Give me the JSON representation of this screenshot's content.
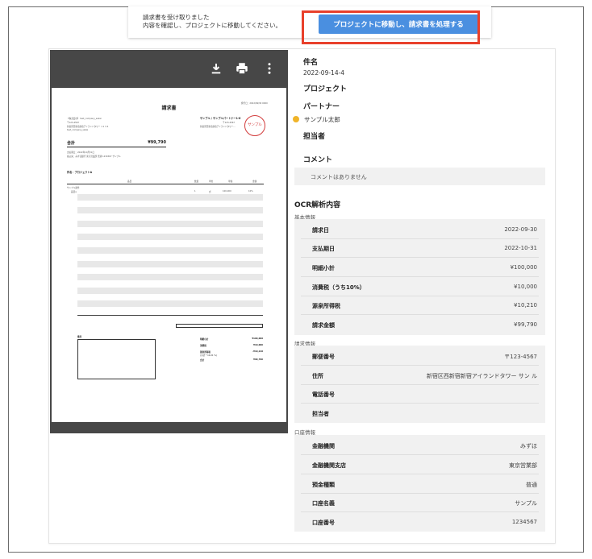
{
  "notice": {
    "line1": "請求書を受け取りました",
    "line2": "内容を確認し、プロジェクトに移動してください。",
    "button_label": "プロジェクトに移動し、請求書を処理する"
  },
  "viewer": {
    "icons": [
      "download-icon",
      "print-icon",
      "more-vert-icon"
    ],
    "doc": {
      "title": "請求書",
      "date_line": "発行日：2022/09/30 0000",
      "customer_name": "【株式会社】 test_company_sakai",
      "customer_zip": "〒123-4567",
      "customer_addr": "新宿区西新宿新宿アイランドタワー 1 1 3 4",
      "customer_person": "test_company_sakai",
      "issuer_name": "サンプル / サンプルパートナー1-6",
      "issuer_zip": "〒123-4567",
      "issuer_addr": "新宿区西新宿新宿アイランドタワー…",
      "seal": "サンプル",
      "total_label": "合計",
      "total_value": "¥99,790",
      "due_line": "支払期日：2022年10月31日",
      "bank_line": "振込先：みずほ銀行 東京営業部 普通 1234567 サンプル",
      "subject": "件名：プロジェクトA",
      "col_item": "品目",
      "col_qty": "数量",
      "col_unit": "単位",
      "col_price": "単価",
      "col_amount": "金額",
      "row_group": "サンプル案件",
      "row_item": "品目a",
      "row_qty": "1",
      "row_unit": "式",
      "row_price": "100,000",
      "row_amount": "10%",
      "memo_label": "備考",
      "sum_subtotal_label": "明細小計",
      "sum_subtotal": "¥100,000",
      "sum_tax_label": "消費税",
      "sum_tax": "¥10,000",
      "sum_wh_label": "源泉所得税",
      "sum_wh_sub": "(小計 * 10.21 %)",
      "sum_wh": "-¥10,210",
      "sum_total_label": "合計",
      "sum_total": "¥99,790"
    }
  },
  "panel": {
    "subject_label": "件名",
    "subject_value": "2022-09-14-4",
    "project_label": "プロジェクト",
    "partner_label": "パートナー",
    "partner_value": "サンプル太郎",
    "assignee_label": "担当者",
    "comment_label": "コメント",
    "comment_empty": "コメントはありません",
    "ocr_label": "OCR解析内容",
    "basic_label": "基本情報",
    "basic": [
      {
        "k": "請求日",
        "v": "2022-09-30"
      },
      {
        "k": "支払期日",
        "v": "2022-10-31"
      },
      {
        "k": "明細小計",
        "v": "¥100,000"
      },
      {
        "k": "消費税（うち10%）",
        "v": "¥10,000"
      },
      {
        "k": "源泉所得税",
        "v": "¥10,210"
      },
      {
        "k": "請求金額",
        "v": "¥99,790"
      }
    ],
    "billing_label": "請求情報",
    "billing": [
      {
        "k": "郵便番号",
        "v": "〒123-4567"
      },
      {
        "k": "住所",
        "v": "新宿区西新宿新宿アイランドタワー サン ル"
      },
      {
        "k": "電話番号",
        "v": ""
      },
      {
        "k": "担当者",
        "v": ""
      }
    ],
    "bank_label": "口座情報",
    "bank": [
      {
        "k": "金融機関",
        "v": "みずほ"
      },
      {
        "k": "金融機関支店",
        "v": "東京営業部"
      },
      {
        "k": "預金種類",
        "v": "普通"
      },
      {
        "k": "口座名義",
        "v": "サンプル"
      },
      {
        "k": "口座番号",
        "v": "1234567"
      }
    ]
  }
}
